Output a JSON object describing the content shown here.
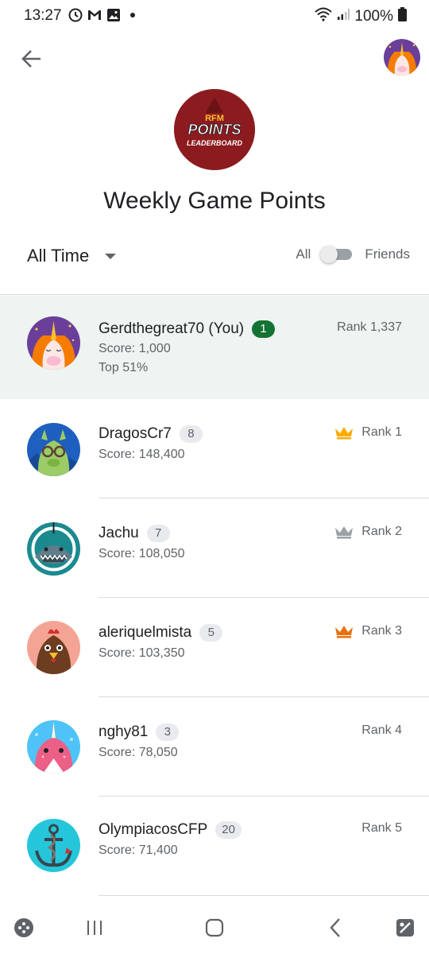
{
  "status_bar": {
    "time": "13:27",
    "battery": "100%"
  },
  "header": {
    "logo": {
      "line1": "RFM",
      "line2": "POINTS",
      "line3": "LEADERBOARD"
    },
    "title": "Weekly Game Points"
  },
  "filters": {
    "time_range": "All Time",
    "toggle_left": "All",
    "toggle_right": "Friends",
    "toggle_on": false
  },
  "colors": {
    "accent_green": "#137333",
    "highlight_row": "#eef4f1",
    "gold": "#f9ab00",
    "silver": "#9aa0a6",
    "bronze": "#e8710a"
  },
  "players": [
    {
      "name": "Gerdthegreat70 (You)",
      "badge": "1",
      "score": "Score: 1,000",
      "top": "Top 51%",
      "rank": "Rank 1,337",
      "crown": "",
      "avatar": "unicorn-avatar"
    },
    {
      "name": "DragosCr7",
      "badge": "8",
      "score": "Score: 148,400",
      "rank": "Rank 1",
      "crown": "gold-crown-icon",
      "avatar": "llama-avatar"
    },
    {
      "name": "Jachu",
      "badge": "7",
      "score": "Score: 108,050",
      "rank": "Rank 2",
      "crown": "silver-crown-icon",
      "avatar": "shark-avatar"
    },
    {
      "name": "aleriquelmista",
      "badge": "5",
      "score": "Score: 103,350",
      "rank": "Rank 3",
      "crown": "bronze-crown-icon",
      "avatar": "rooster-avatar"
    },
    {
      "name": "nghy81",
      "badge": "3",
      "score": "Score: 78,050",
      "rank": "Rank 4",
      "crown": "",
      "avatar": "narwhal-avatar"
    },
    {
      "name": "OlympiacosCFP",
      "badge": "20",
      "score": "Score: 71,400",
      "rank": "Rank 5",
      "crown": "",
      "avatar": "anchor-avatar"
    }
  ]
}
